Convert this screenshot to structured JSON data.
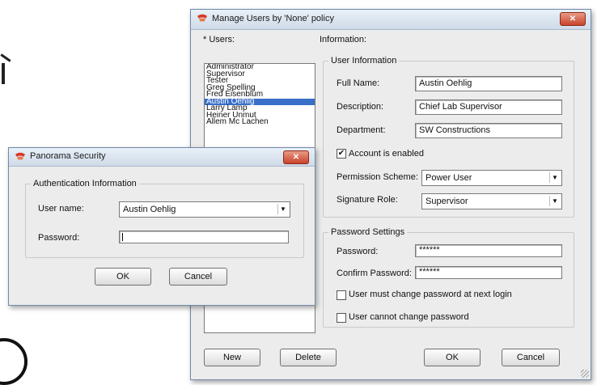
{
  "manage_window": {
    "title": "Manage Users by 'None' policy",
    "users_label": "* Users:",
    "information_label": "Information:",
    "users": [
      "Administrator",
      "Supervisor",
      "Tester",
      "Greg Spelling",
      "Fred Eisenblum",
      "Austin Oehlig",
      "Larry Lamp",
      "Heiner Unmut",
      "Allem Mc Lachen"
    ],
    "selected_user_index": 5,
    "user_information": {
      "group_title": "User Information",
      "full_name_label": "Full Name:",
      "full_name_value": "Austin Oehlig",
      "description_label": "Description:",
      "description_value": "Chief Lab Supervisor",
      "department_label": "Department:",
      "department_value": "SW Constructions",
      "account_enabled_label": "Account is enabled",
      "account_enabled_checked": true,
      "permission_label": "Permission Scheme:",
      "permission_value": "Power User",
      "signature_label": "Signature Role:",
      "signature_value": "Supervisor"
    },
    "password_settings": {
      "group_title": "Password Settings",
      "password_label": "Password:",
      "password_value": "******",
      "confirm_label": "Confirm Password:",
      "confirm_value": "******",
      "must_change_label": "User must change password at next login",
      "cannot_change_label": "User cannot change password"
    },
    "buttons": {
      "new": "New",
      "delete": "Delete",
      "ok": "OK",
      "cancel": "Cancel"
    },
    "close_glyph": "✕"
  },
  "security_window": {
    "title": "Panorama Security",
    "group_title": "Authentication Information",
    "username_label": "User name:",
    "username_value": "Austin Oehlig",
    "password_label": "Password:",
    "password_value": "",
    "buttons": {
      "ok": "OK",
      "cancel": "Cancel"
    },
    "close_glyph": "✕"
  },
  "icons": {
    "app_icon": "shield-icon",
    "dropdown": "chevron-down-icon",
    "check": "✔",
    "arrow_glyph": "▼"
  }
}
